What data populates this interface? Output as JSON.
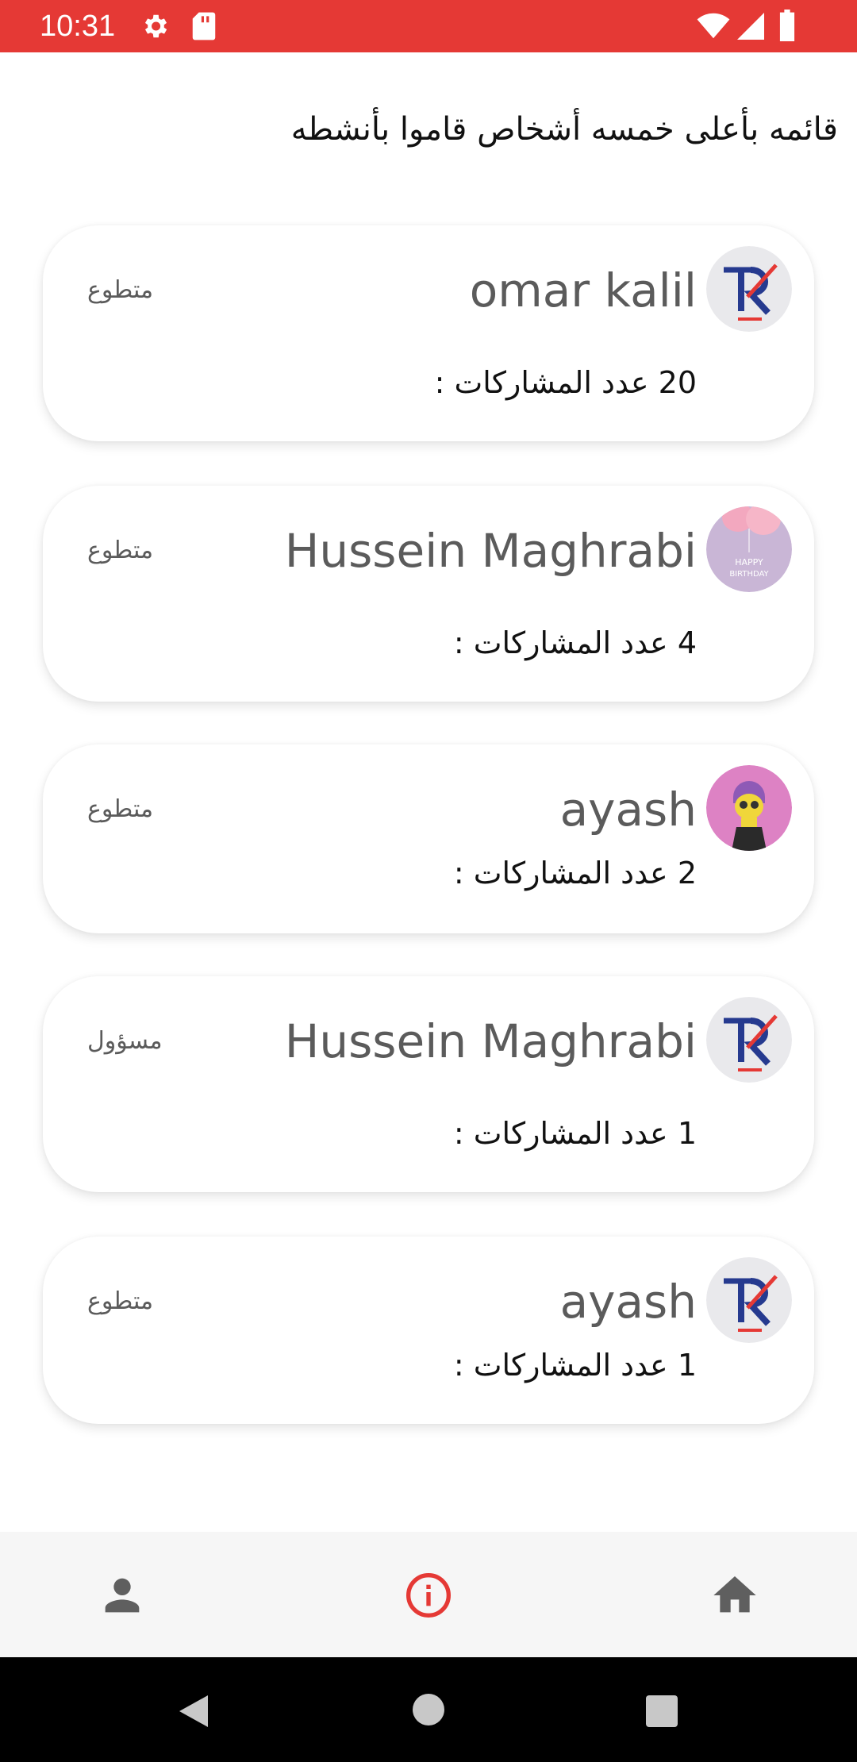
{
  "status_bar": {
    "time": "10:31",
    "icons": [
      "settings-icon",
      "sd-card-icon",
      "wifi-icon",
      "signal-icon",
      "battery-icon"
    ]
  },
  "heading": "قائمه بأعلى خمسه أشخاص قاموا بأنشطه",
  "count_label": "عدد المشاركات :",
  "people": [
    {
      "name": "omar kalil",
      "role": "متطوع",
      "count": "20",
      "avatar": "logo-k"
    },
    {
      "name": "Hussein Maghrabi",
      "role": "متطوع",
      "count": "4",
      "avatar": "birthday"
    },
    {
      "name": "ayash",
      "role": "متطوع",
      "count": "2",
      "avatar": "alien"
    },
    {
      "name": "Hussein Maghrabi",
      "role": "مسؤول",
      "count": "1",
      "avatar": "logo-k"
    },
    {
      "name": "ayash",
      "role": "متطوع",
      "count": "1",
      "avatar": "logo-k"
    }
  ],
  "bottom_nav": {
    "items": [
      "person-icon",
      "info-icon",
      "home-icon"
    ],
    "active": "info-icon",
    "active_color": "#e53935"
  },
  "colors": {
    "status_bar": "#e53935",
    "text_secondary": "#5b5b5b"
  }
}
